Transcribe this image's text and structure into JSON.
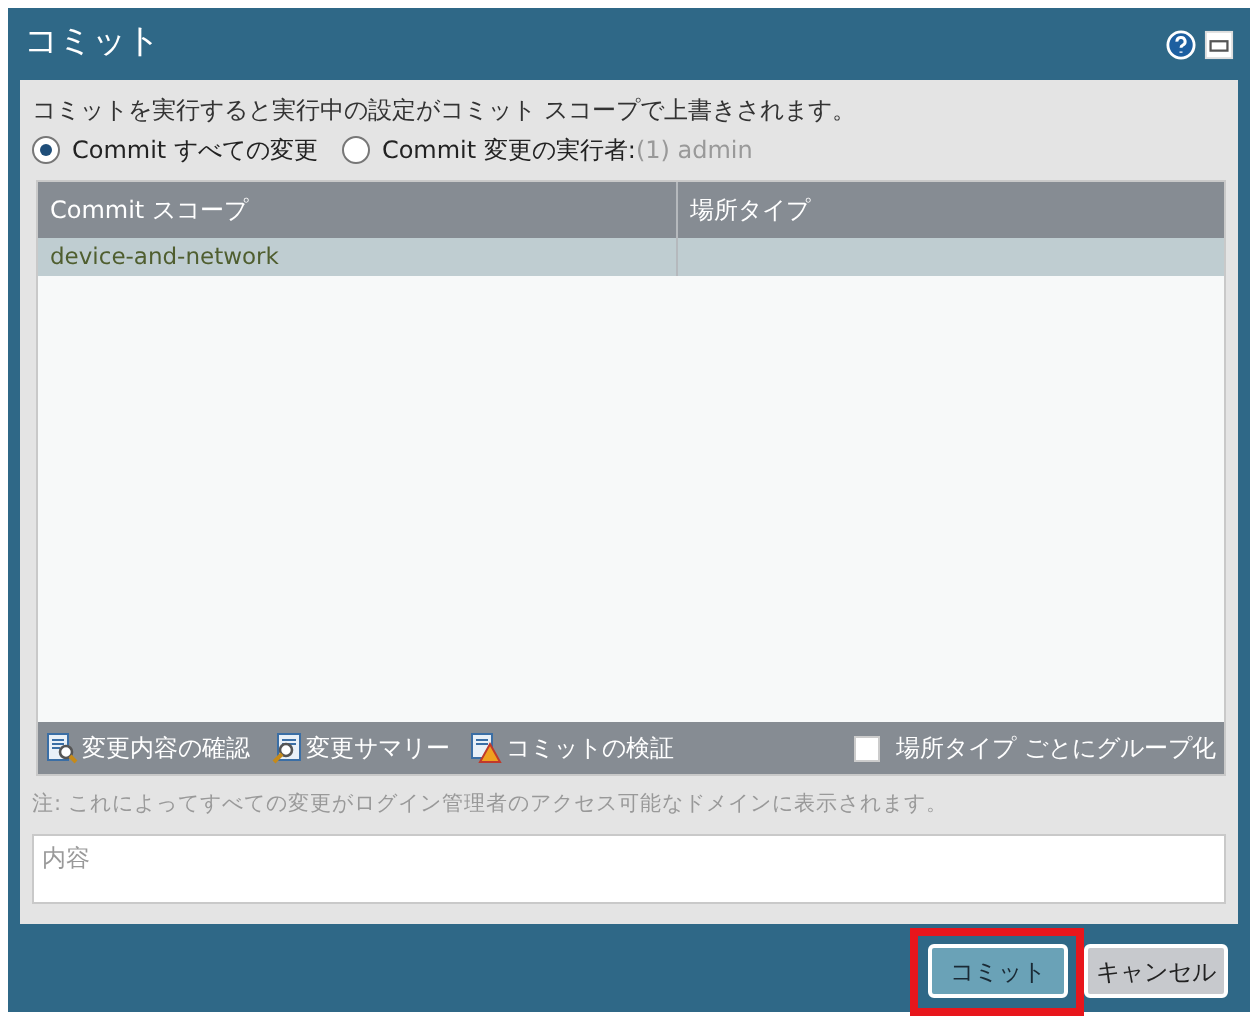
{
  "window": {
    "title": "コミット"
  },
  "message": "コミットを実行すると実行中の設定がコミット スコープで上書きされます。",
  "commit_options": [
    {
      "label": "Commit すべての変更",
      "selected": true
    },
    {
      "label": "Commit 変更の実行者:",
      "suffix": "(1) admin",
      "selected": false
    }
  ],
  "table": {
    "columns": [
      "Commit スコープ",
      "場所タイプ"
    ],
    "rows": [
      {
        "cells": [
          "device-and-network",
          ""
        ],
        "selected": true
      }
    ]
  },
  "toolbar": {
    "actions": [
      {
        "label": "変更内容の確認",
        "kind": "preview"
      },
      {
        "label": "変更サマリー",
        "kind": "summary"
      },
      {
        "label": "コミットの検証",
        "kind": "validate"
      }
    ],
    "group_by": {
      "label": "場所タイプ ごとにグループ化",
      "checked": false
    }
  },
  "note": "注: これによってすべての変更がログイン管理者のアクセス可能なドメインに表示されます。",
  "description": {
    "placeholder": "内容"
  },
  "buttons": [
    {
      "label": "コミット",
      "kind": "primary",
      "highlighted": true
    },
    {
      "label": "キャンセル",
      "kind": "secondary",
      "highlighted": false
    }
  ]
}
